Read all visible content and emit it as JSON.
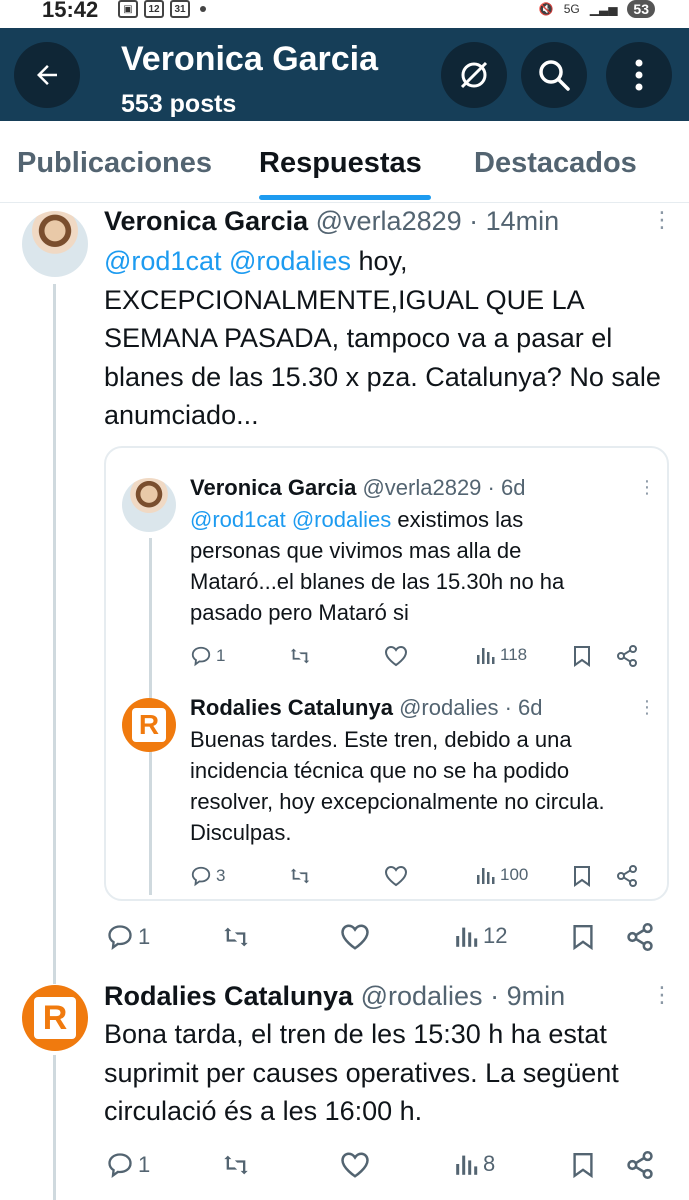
{
  "status_bar": {
    "time": "15:42",
    "icon_a": "12",
    "icon_b": "31",
    "net": "5G",
    "battery": "53"
  },
  "header": {
    "title": "Veronica Garcia",
    "subtitle": "553 posts"
  },
  "tabs": [
    {
      "label": "Publicaciones"
    },
    {
      "label": "Respuestas"
    },
    {
      "label": "Destacados"
    }
  ],
  "tweet1": {
    "name": "Veronica Garcia",
    "handle": "@verla2829",
    "time": "· 14min",
    "mention1": "@rod1cat",
    "mention2": "@rodalies",
    "text": " hoy, EXCEPCIONALMENTE,IGUAL QUE LA SEMANA PASADA, tampoco va a pasar el blanes de las 15.30 x pza. Catalunya? No sale anumciado...",
    "replies": "1",
    "views": "12"
  },
  "quote": {
    "tweetA": {
      "name": "Veronica Garcia",
      "handle": "@verla2829",
      "time": "· 6d",
      "mention1": "@rod1cat",
      "mention2": "@rodalies",
      "text": " existimos las personas que vivimos mas alla de Mataró...el blanes de las 15.30h no ha pasado pero Mataró si",
      "replies": "1",
      "views": "118"
    },
    "tweetB": {
      "name": "Rodalies Catalunya",
      "handle": "@rodalies",
      "time": "· 6d",
      "avatar_letter": "R",
      "text": "Buenas tardes. Este tren, debido a una incidencia técnica que no se ha podido resolver, hoy excepcionalmente no circula. Disculpas.",
      "replies": "3",
      "views": "100"
    }
  },
  "tweet2": {
    "name": "Rodalies Catalunya",
    "handle": "@rodalies",
    "time": "· 9min",
    "avatar_letter": "R",
    "text": "Bona tarda, el tren de les 15:30 h ha estat suprimit per causes operatives. La següent circulació és a les 16:00 h.",
    "replies": "1",
    "views": "8"
  },
  "colors": {
    "header_bg": "#163e58",
    "accent": "#1d9bf0",
    "rodalies_orange": "#f07a0e"
  }
}
